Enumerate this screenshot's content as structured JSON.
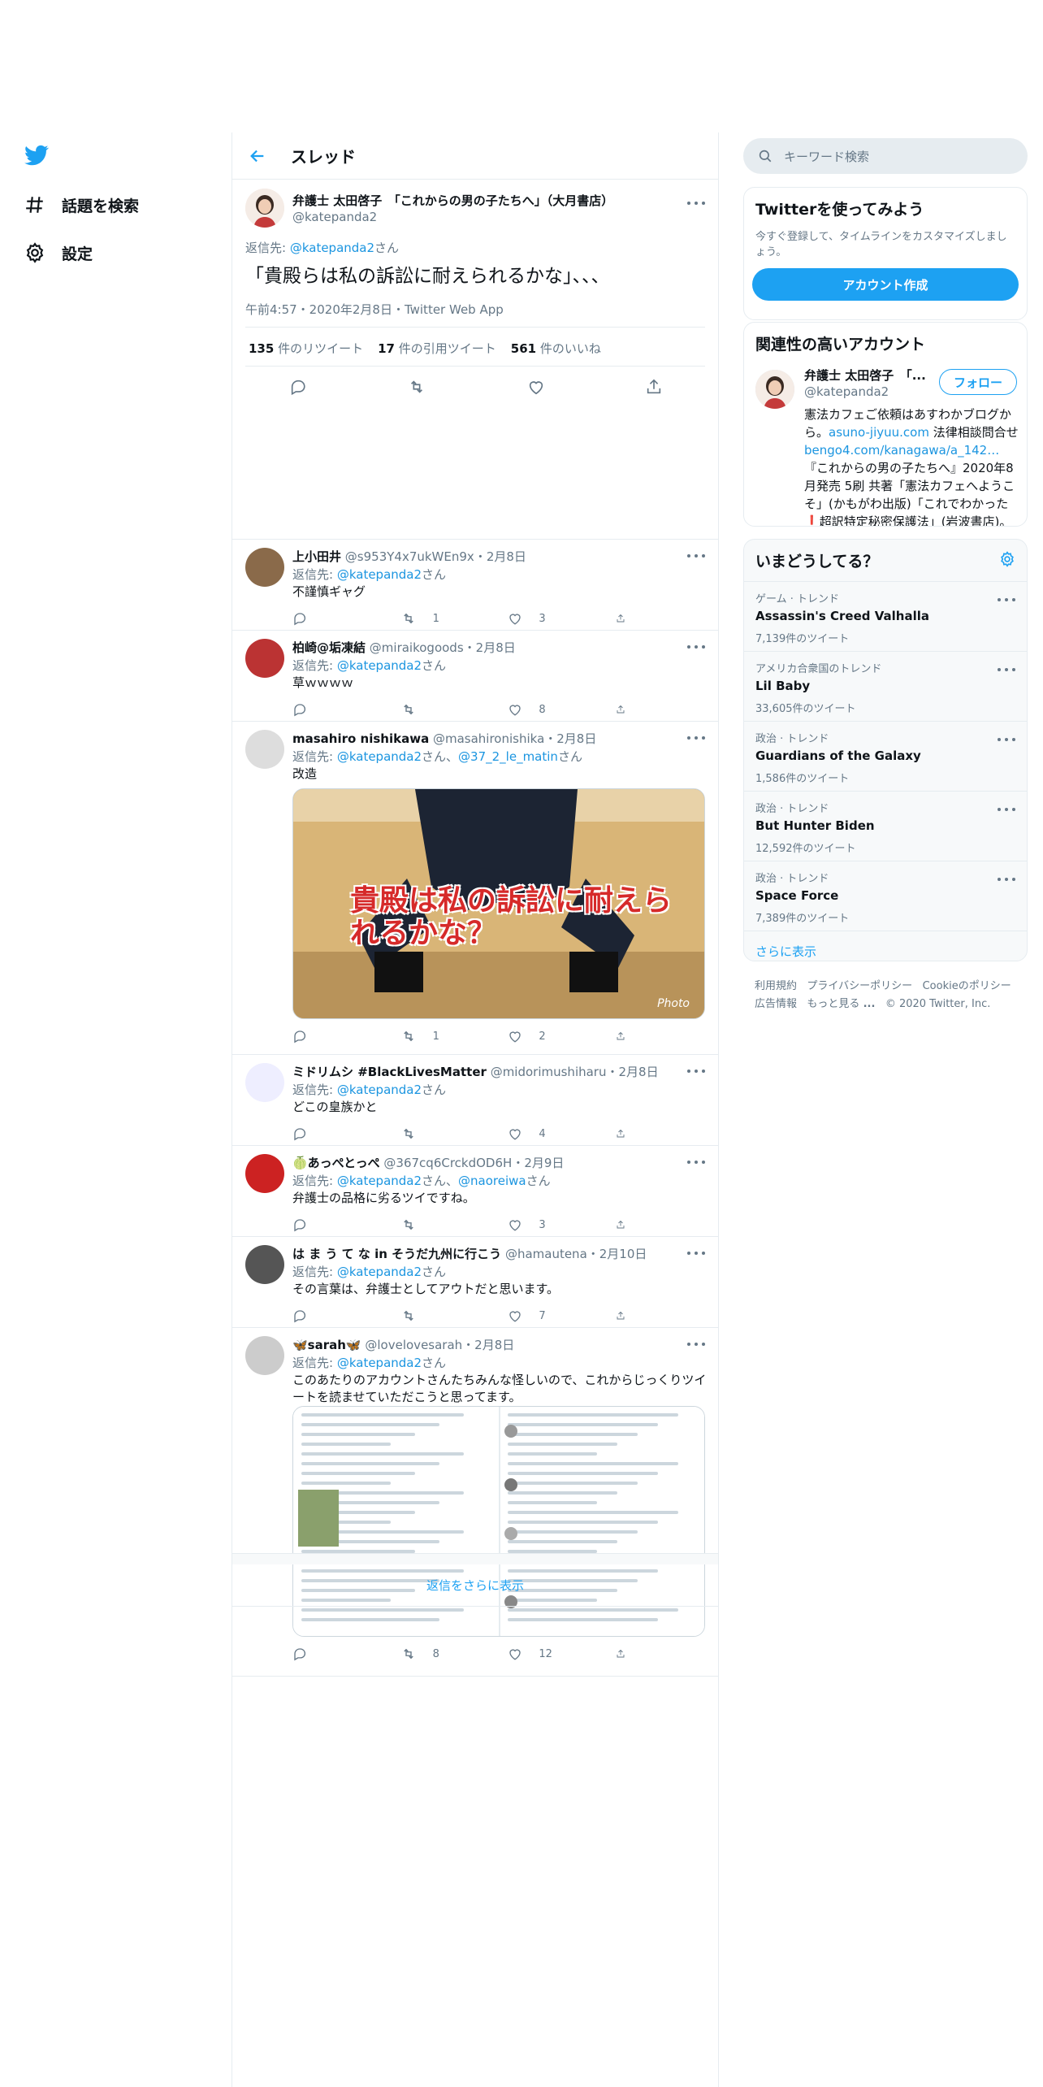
{
  "nav": {
    "explore": "話題を検索",
    "settings": "設定"
  },
  "header": {
    "title": "スレッド"
  },
  "main_tweet": {
    "name": "弁護士 太田啓子　「これからの男の子たちへ」（大月書店）",
    "handle": "@katepanda2",
    "reply_prefix": "返信先: ",
    "reply_to": "@katepanda2",
    "reply_suffix": "さん",
    "text": "「貴殿らは私の訴訟に耐えられるかな」、、、",
    "meta": "午前4:57・2020年2月8日・Twitter Web App",
    "rt_count": "135",
    "rt_label": "件のリツイート",
    "qt_count": "17",
    "qt_label": "件の引用ツイート",
    "like_count": "561",
    "like_label": "件のいいね"
  },
  "replies": [
    {
      "name": "上小田井",
      "handle": "@s953Y4x7ukWEn9x",
      "date": "・2月8日",
      "reply_to": "@katepanda2",
      "text": "不謹慎ギャグ",
      "rt": "1",
      "like": "3"
    },
    {
      "name": "柏崎@垢凍結",
      "handle": "@miraikogoods",
      "date": "・2月8日",
      "reply_to": "@katepanda2",
      "text": "草ｗｗｗｗ",
      "rt": "",
      "like": "8"
    },
    {
      "name": "masahiro nishikawa",
      "handle": "@masahironishika",
      "date": "・2月8日",
      "reply_to": "@katepanda2",
      "reply_to2": "@37_2_le_matin",
      "text": "改造",
      "image_text": "貴殿は私の訴訟に耐えられるかな？",
      "image_caption": "Photo",
      "rt": "1",
      "like": "2"
    },
    {
      "name": "ミドリムシ #BlackLivesMatter",
      "handle": "@midorimushiharu",
      "date": "・2月8日",
      "reply_to": "@katepanda2",
      "text": "どこの皇族かと",
      "rt": "",
      "like": "4"
    },
    {
      "name": "🍈あっぺとっぺ",
      "handle": "@367cq6CrckdOD6H",
      "date": "・2月9日",
      "reply_to": "@katepanda2",
      "reply_to2": "@naoreiwa",
      "text": "弁護士の品格に劣るツイですね。",
      "rt": "",
      "like": "3"
    },
    {
      "name": "は ま う て な in そうだ九州に行こう",
      "handle": "@hamautena",
      "date": "・2月10日",
      "reply_to": "@katepanda2",
      "text": "その言葉は、弁護士としてアウトだと思います。",
      "rt": "",
      "like": "7"
    },
    {
      "name": "🦋sarah🦋",
      "handle": "@lovelovesarah",
      "date": "・2月8日",
      "reply_to": "@katepanda2",
      "text": "このあたりのアカウントさんたちみんな怪しいので、これからじっくりツイートを読ませていただこうと思ってます。",
      "rt": "8",
      "like": "12"
    }
  ],
  "common": {
    "reply_prefix": "返信先: ",
    "san": "さん",
    "and": "、",
    "and_san": "さん、"
  },
  "show_more_replies": "返信をさらに表示",
  "sidebar": {
    "search_placeholder": "キーワード検索",
    "signup_title": "Twitterを使ってみよう",
    "signup_text": "今すぐ登録して、タイムラインをカスタマイズしましょう。",
    "signup_button": "アカウント作成",
    "related_title": "関連性の高いアカウント",
    "related_name": "弁護士 太田啓子　「...",
    "related_handle": "@katepanda2",
    "follow_label": "フォロー",
    "related_bio_1": "憲法カフェご依頼はあすわかブログから。",
    "related_bio_link1": "asuno-jiyuu.com",
    "related_bio_2": " 法律相談問合せ",
    "related_bio_link2": "bengo4.com/kanagawa/a_142…",
    "related_bio_3": "『これからの男の子たちへ』2020年8月発売 5刷 共著「憲法カフェへようこそ」(かもがわ出版)「これでわかった",
    "related_bio_4": "超訳特定秘密保護法」(岩波書店)。",
    "trends_title": "いまどうしてる？",
    "trends": [
      {
        "category": "ゲーム · トレンド",
        "name": "Assassin's Creed Valhalla",
        "count": "7,139件のツイート"
      },
      {
        "category": "アメリカ合衆国のトレンド",
        "name": "Lil Baby",
        "count": "33,605件のツイート"
      },
      {
        "category": "政治 · トレンド",
        "name": "Guardians of the Galaxy",
        "count": "1,586件のツイート"
      },
      {
        "category": "政治 · トレンド",
        "name": "But Hunter Biden",
        "count": "12,592件のツイート"
      },
      {
        "category": "政治 · トレンド",
        "name": "Space Force",
        "count": "7,389件のツイート"
      }
    ],
    "show_more": "さらに表示",
    "footer": {
      "terms": "利用規約",
      "privacy": "プライバシーポリシー",
      "cookie": "Cookieのポリシー",
      "ads": "広告情報",
      "more": "もっと見る",
      "copyright": "© 2020 Twitter, Inc."
    }
  },
  "colors": {
    "accent": "#1da1f2",
    "text": "#0f1419",
    "secondary": "#657786",
    "border": "#e6ecf0"
  }
}
